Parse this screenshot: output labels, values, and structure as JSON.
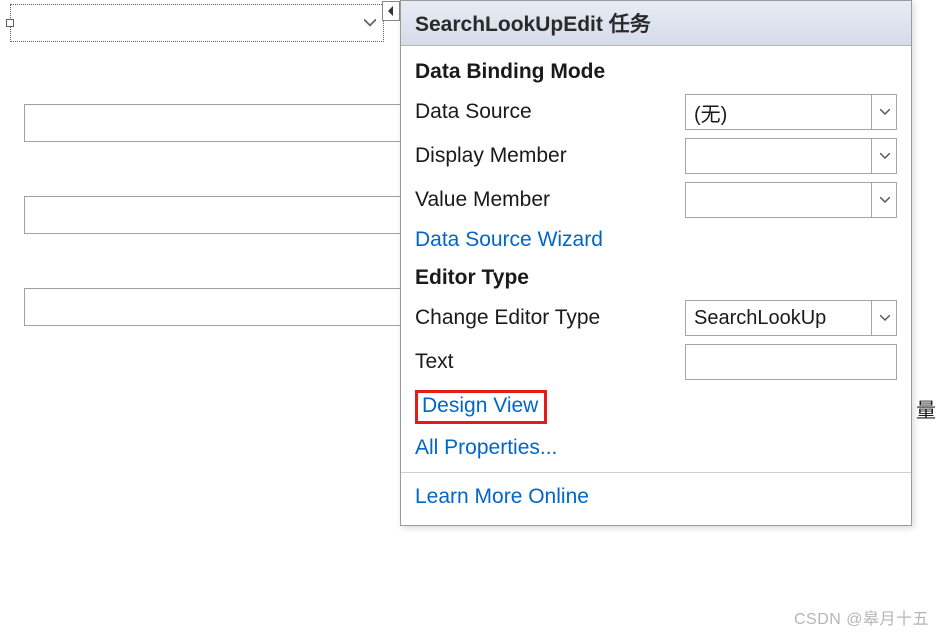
{
  "designer": {
    "bg_char": "量"
  },
  "taskPanel": {
    "title": "SearchLookUpEdit 任务",
    "sections": {
      "binding": {
        "title": "Data Binding Mode",
        "dataSource": {
          "label": "Data Source",
          "value": "(无)"
        },
        "displayMember": {
          "label": "Display Member",
          "value": ""
        },
        "valueMember": {
          "label": "Value Member",
          "value": ""
        },
        "wizardLink": "Data Source Wizard"
      },
      "editor": {
        "title": "Editor Type",
        "changeType": {
          "label": "Change Editor Type",
          "value": "SearchLookUp"
        },
        "text": {
          "label": "Text",
          "value": ""
        },
        "designViewLink": "Design View",
        "allPropsLink": "All Properties...",
        "learnMoreLink": "Learn More Online"
      }
    }
  },
  "watermark": "CSDN @皋月十五"
}
